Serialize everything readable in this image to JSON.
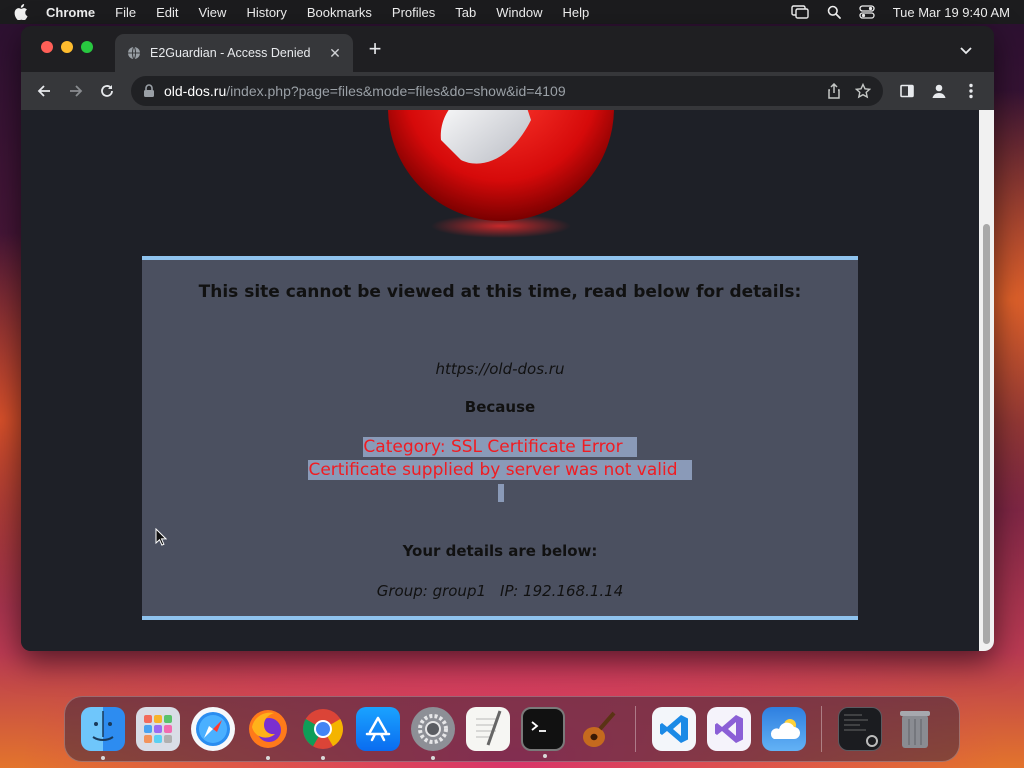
{
  "menubar": {
    "items": [
      "Chrome",
      "File",
      "Edit",
      "View",
      "History",
      "Bookmarks",
      "Profiles",
      "Tab",
      "Window",
      "Help"
    ],
    "clock": "Tue Mar 19  9:40 AM"
  },
  "browser": {
    "tab_title": "E2Guardian - Access Denied",
    "url_host": "old-dos.ru",
    "url_path": "/index.php?page=files&mode=files&do=show&id=4109"
  },
  "page": {
    "headline": "This site cannot be viewed at this time, read below for details:",
    "blocked_url": "https://old-dos.ru",
    "because_label": "Because",
    "reason_line1": "Category: SSL Certificate Error",
    "reason_line2": "Certificate supplied by server was not valid",
    "details_heading": "Your details are below:",
    "group_text": "Group: group1",
    "ip_text": "IP: 192.168.1.14"
  },
  "colors": {
    "page_background": "#1e2027",
    "panel_background": "#4b5060",
    "panel_border": "#8fc3ee",
    "reason_text": "#f01c22",
    "selection": "#8a9ab8"
  },
  "dock": {
    "apps": [
      "finder",
      "launchpad",
      "safari",
      "firefox",
      "chrome",
      "app-store",
      "system-settings",
      "textedit",
      "terminal",
      "garageband",
      "vscode",
      "visual-studio",
      "weather",
      "recent-window",
      "trash"
    ]
  }
}
